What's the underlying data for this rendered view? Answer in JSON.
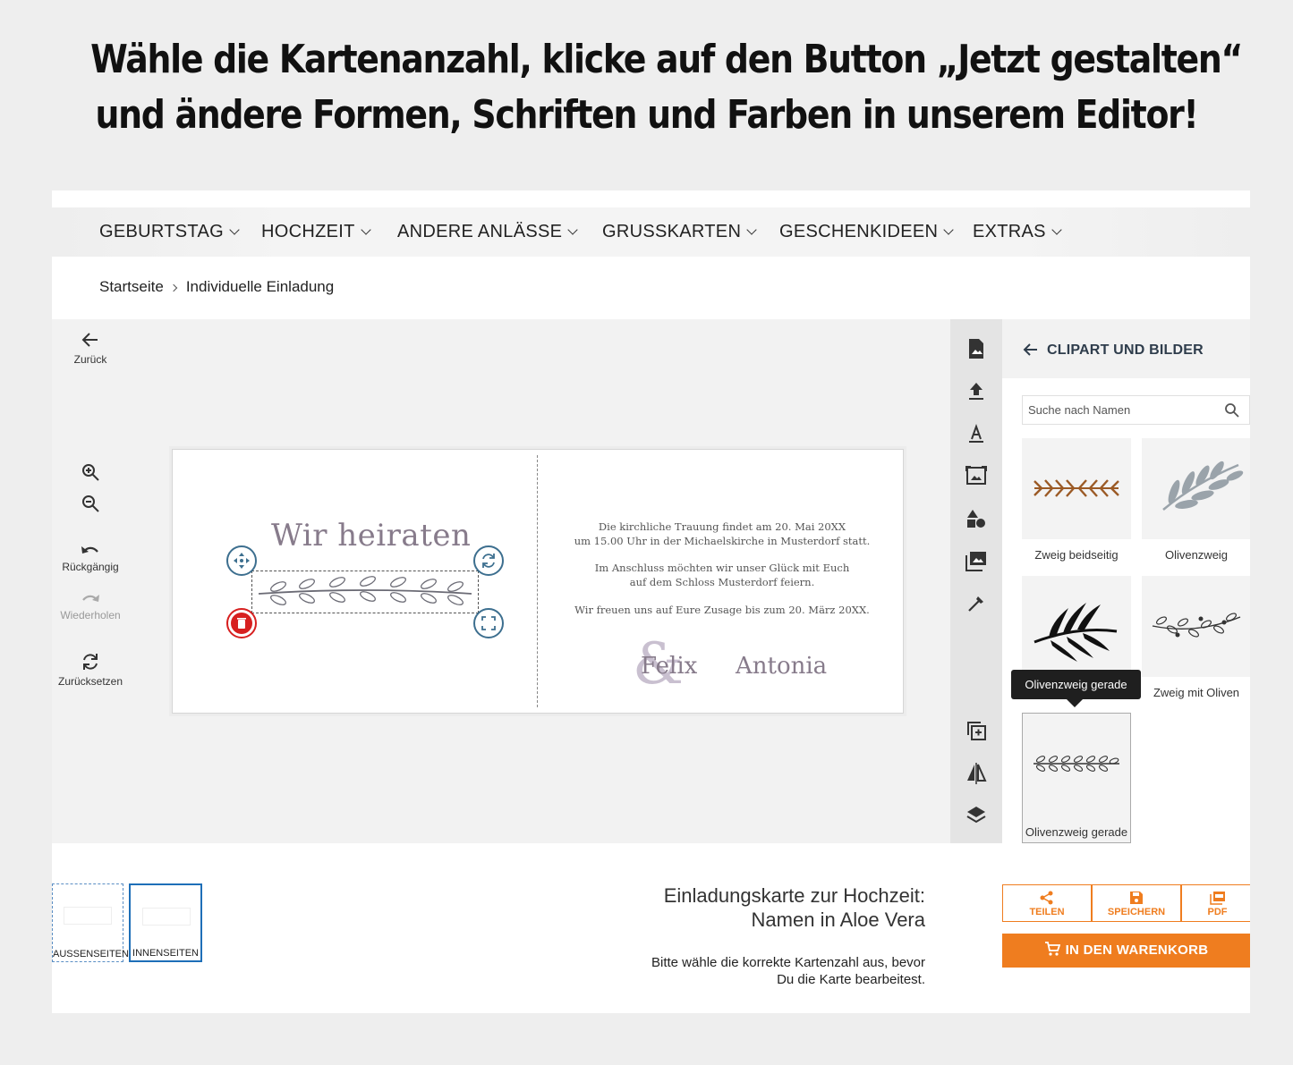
{
  "headline": {
    "line1": "Wähle die Kartenanzahl, klicke auf den Button „Jetzt gestalten“",
    "line2": "und ändere Formen, Schriften und Farben in unserem Editor!"
  },
  "nav": {
    "items": [
      {
        "label": "GEBURTSTAG"
      },
      {
        "label": "HOCHZEIT"
      },
      {
        "label": "ANDERE ANLÄSSE"
      },
      {
        "label": "GRUSSKARTEN"
      },
      {
        "label": "GESCHENKIDEEN"
      },
      {
        "label": "EXTRAS"
      }
    ]
  },
  "breadcrumb": {
    "home": "Startseite",
    "current": "Individuelle Einladung"
  },
  "lefttools": {
    "back": "Zurück",
    "undo": "Rückgängig",
    "redo": "Wiederholen",
    "reset": "Zurücksetzen"
  },
  "card": {
    "front_title": "Wir heiraten",
    "p1_l1": "Die kirchliche Trauung findet am 20. Mai 20XX",
    "p1_l2": "um 15.00 Uhr in der Michaelskirche in Musterdorf statt.",
    "p2_l1": "Im Anschluss möchten wir unser Glück mit Euch",
    "p2_l2": "auf dem Schloss Musterdorf feiern.",
    "p3": "Wir freuen uns auf Eure Zusage bis zum 20. März 20XX.",
    "name1": "Felix",
    "amp": "&",
    "name2": "Antonia"
  },
  "panel": {
    "title": "CLIPART UND BILDER",
    "search_placeholder": "Suche nach Namen",
    "tiles": [
      {
        "label": "Zweig beidseitig"
      },
      {
        "label": "Olivenzweig"
      },
      {
        "label": ""
      },
      {
        "label": "Zweig mit Oliven"
      },
      {
        "label": "Olivenzweig gerade"
      }
    ],
    "tooltip": "Olivenzweig gerade"
  },
  "bottom": {
    "thumbs": [
      {
        "label": "AUSSENSEITEN"
      },
      {
        "label": "INNENSEITEN"
      }
    ],
    "product_title_l1": "Einladungskarte zur Hochzeit:",
    "product_title_l2": "Namen in Aloe Vera",
    "note_l1": "Bitte wähle die korrekte Kartenzahl aus, bevor",
    "note_l2": "Du die Karte bearbeitest.",
    "share": "TEILEN",
    "save": "SPEICHERN",
    "pdf": "PDF",
    "cart": "IN DEN WARENKORB"
  },
  "colors": {
    "accent": "#ef7d1f",
    "handle": "#3d6f8f",
    "delete": "#d72020",
    "selected_thumb": "#1e6fb8"
  }
}
